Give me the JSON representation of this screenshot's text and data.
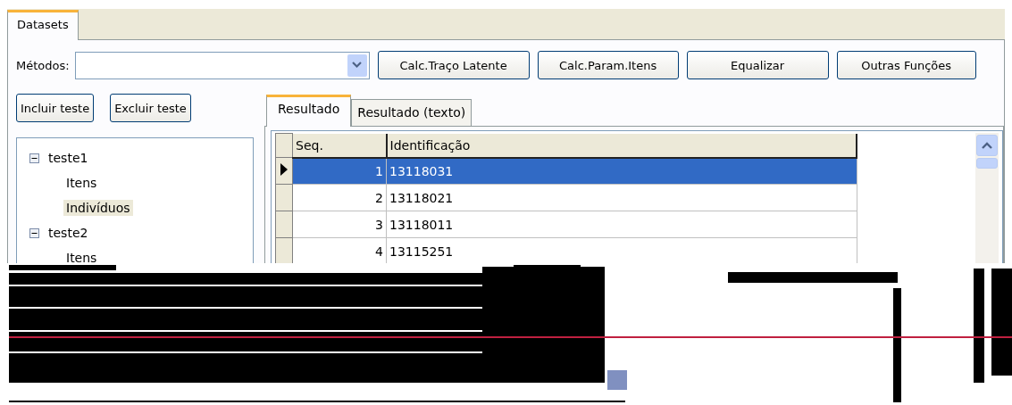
{
  "tabs": [
    {
      "label": "Datasets",
      "selected": true
    }
  ],
  "methods": {
    "label": "Métodos:"
  },
  "toolbar_buttons": [
    "Calc.Traço Latente",
    "Calc.Param.Itens",
    "Equalizar",
    "Outras Funções"
  ],
  "test_buttons": [
    "Incluir teste",
    "Excluir teste"
  ],
  "tree": [
    {
      "label": "teste1",
      "expanded": true,
      "selected": false,
      "children": [
        {
          "label": "Itens",
          "selected": false
        },
        {
          "label": "Indivíduos",
          "selected": true
        }
      ]
    },
    {
      "label": "teste2",
      "expanded": true,
      "selected": false,
      "children": [
        {
          "label": "Itens",
          "selected": false
        }
      ]
    }
  ],
  "result_tabs": [
    {
      "label": "Resultado",
      "selected": true
    },
    {
      "label": "Resultado (texto)",
      "selected": false
    }
  ],
  "grid": {
    "columns": [
      "Seq.",
      "Identificação"
    ],
    "rows": [
      {
        "cells": [
          "1",
          "13118031"
        ],
        "selected": true
      },
      {
        "cells": [
          "2",
          "13118021"
        ],
        "selected": false
      },
      {
        "cells": [
          "3",
          "13118011"
        ],
        "selected": false
      },
      {
        "cells": [
          "4",
          "13115251"
        ],
        "selected": false
      }
    ]
  }
}
